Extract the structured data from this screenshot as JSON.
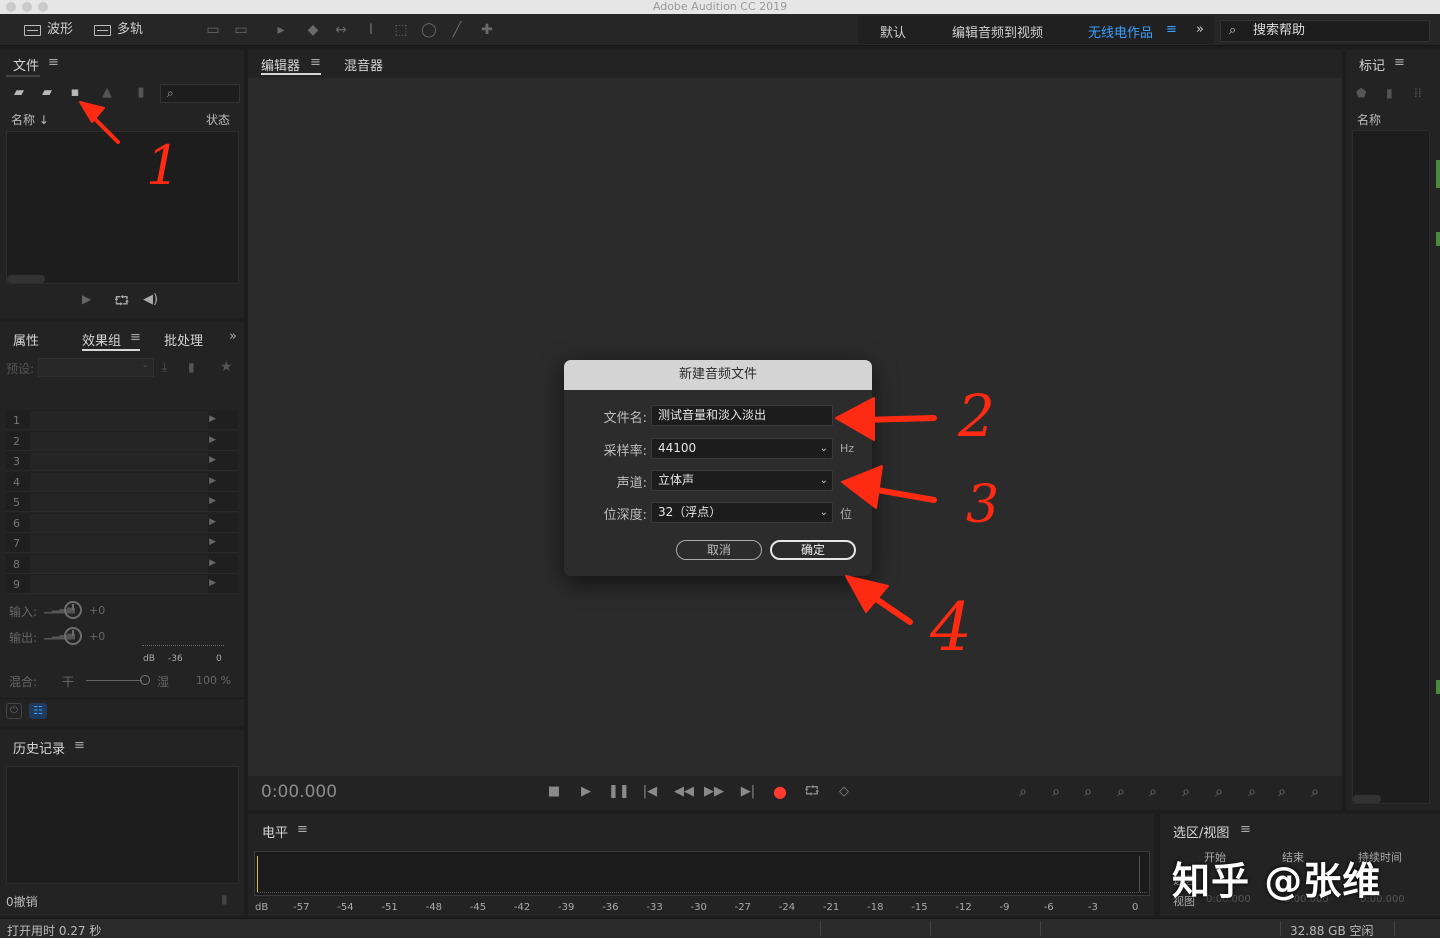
{
  "window": {
    "title": "Adobe Audition CC 2019"
  },
  "toolbar": {
    "waveform_label": "波形",
    "multitrack_label": "多轨",
    "workspaces": [
      "默认",
      "编辑音频到视频",
      "无线电作品"
    ],
    "active_workspace": "无线电作品",
    "accent_color": "#3aa0ff",
    "search_label": "搜索帮助"
  },
  "files_panel": {
    "title": "文件",
    "col_name": "名称",
    "col_status": "状态"
  },
  "effects_panel": {
    "tabs": [
      "属性",
      "效果组",
      "批处理"
    ],
    "preset_label": "预设:",
    "rack_slots": [
      "1",
      "2",
      "3",
      "4",
      "5",
      "6",
      "7",
      "8",
      "9"
    ],
    "input_label": "输入:",
    "output_label": "输出:",
    "input_value": "+0",
    "output_value": "+0",
    "meter_scale": [
      "dB",
      "-36",
      "0"
    ],
    "mix_label": "混合:",
    "dry_label": "干",
    "wet_label": "湿",
    "mix_percent": "100 %"
  },
  "history_panel": {
    "title": "历史记录",
    "undo_text": "0撤销"
  },
  "editor": {
    "tabs": [
      "编辑器",
      "混音器"
    ],
    "time": "0:00.000"
  },
  "markers_panel": {
    "title": "标记",
    "col_name": "名称"
  },
  "dialog": {
    "title": "新建音频文件",
    "filename_label": "文件名:",
    "filename_value": "测试音量和淡入淡出",
    "samplerate_label": "采样率:",
    "samplerate_value": "44100",
    "samplerate_unit": "Hz",
    "channels_label": "声道:",
    "channels_value": "立体声",
    "bitdepth_label": "位深度:",
    "bitdepth_value": "32（浮点）",
    "bitdepth_unit": "位",
    "cancel_label": "取消",
    "ok_label": "确定"
  },
  "levels_panel": {
    "title": "电平",
    "ticks": [
      "dB",
      "-57",
      "-54",
      "-51",
      "-48",
      "-45",
      "-42",
      "-39",
      "-36",
      "-33",
      "-30",
      "-27",
      "-24",
      "-21",
      "-18",
      "-15",
      "-12",
      "-9",
      "-6",
      "-3",
      "0"
    ]
  },
  "selection_panel": {
    "title": "选区/视图",
    "col_start": "开始",
    "col_end": "结束",
    "col_duration": "持续时间",
    "row_selection": "选区",
    "row_view": "视图",
    "view_start": "0:00.000",
    "view_end": "0:00.000",
    "view_duration": "0:00.000"
  },
  "statusbar": {
    "open_time": "打开用时 0.27 秒",
    "disk_free": "32.88 GB 空闲"
  },
  "annotations": {
    "numbers": [
      "1",
      "2",
      "3",
      "4"
    ],
    "color": "#ff2a12"
  },
  "watermark": {
    "text": "知乎 @张维"
  }
}
